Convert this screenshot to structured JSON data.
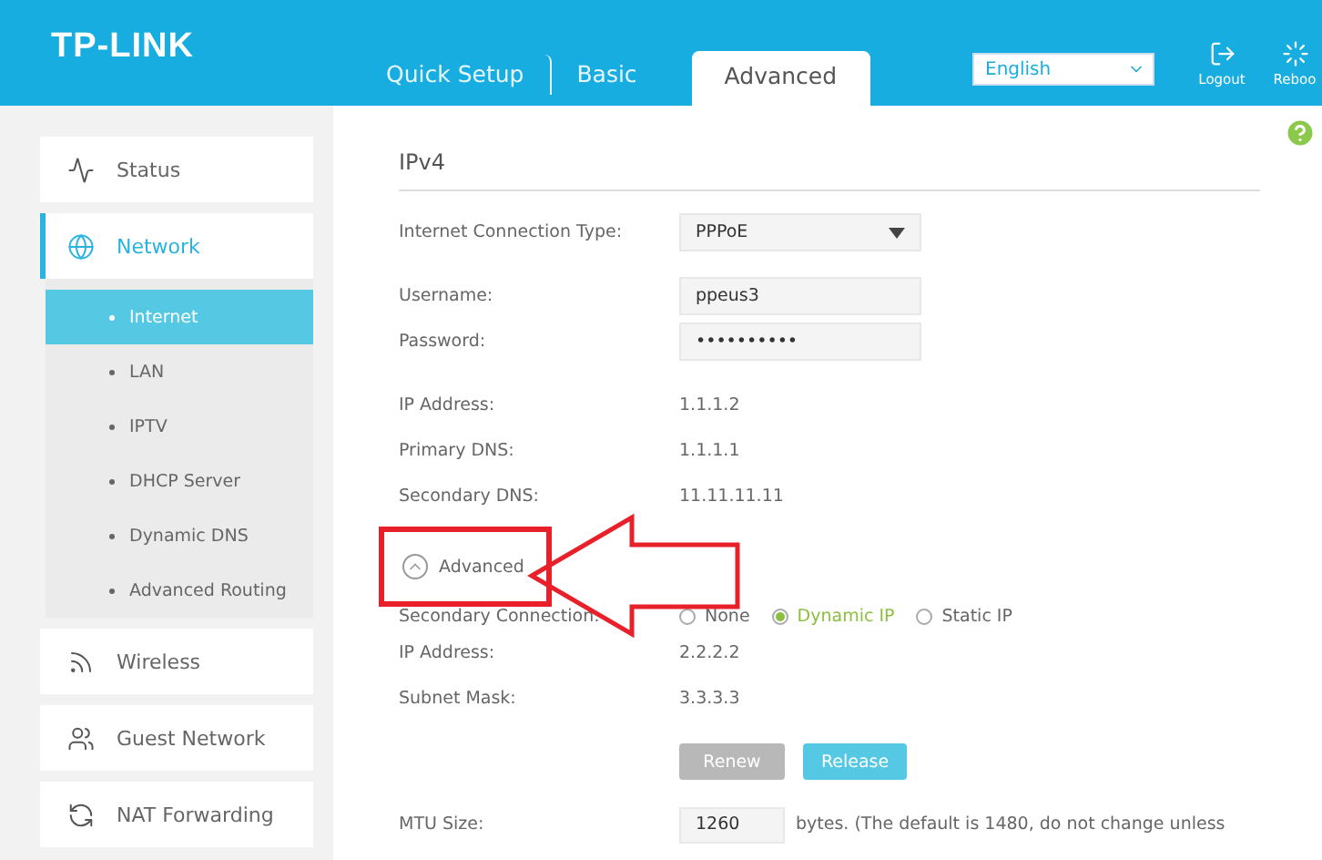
{
  "header": {
    "logo": "TP-LINK",
    "tabs": [
      {
        "label": "Quick Setup",
        "selected": false
      },
      {
        "label": "Basic",
        "selected": false
      },
      {
        "label": "Advanced",
        "selected": true
      }
    ],
    "language": "English",
    "actions": [
      {
        "kind": "logout",
        "label": "Logout"
      },
      {
        "kind": "reboot",
        "label": "Reboo"
      }
    ]
  },
  "sidebar": {
    "items": [
      {
        "label": "Status",
        "selected": false
      },
      {
        "label": "Network",
        "selected": true,
        "expanded": true,
        "children": [
          {
            "label": "Internet",
            "selected": true
          },
          {
            "label": "LAN",
            "selected": false
          },
          {
            "label": "IPTV",
            "selected": false
          },
          {
            "label": "DHCP Server",
            "selected": false
          },
          {
            "label": "Dynamic DNS",
            "selected": false
          },
          {
            "label": "Advanced Routing",
            "selected": false
          }
        ]
      },
      {
        "label": "Wireless",
        "selected": false
      },
      {
        "label": "Guest Network",
        "selected": false
      },
      {
        "label": "NAT Forwarding",
        "selected": false
      }
    ]
  },
  "main": {
    "section_title": "IPv4",
    "groups": [
      {
        "fields": [
          {
            "kind": "select",
            "label": "Internet Connection Type:",
            "value": "PPPoE"
          }
        ]
      },
      {
        "fields": [
          {
            "kind": "input",
            "label": "Username:",
            "value": "ppeus3"
          },
          {
            "kind": "input",
            "label": "Password:",
            "value": "••••••••••"
          }
        ]
      },
      {
        "fields": [
          {
            "kind": "text",
            "label": "IP Address:",
            "value": "1.1.1.2"
          },
          {
            "kind": "text",
            "label": "Primary DNS:",
            "value": "1.1.1.1"
          },
          {
            "kind": "text",
            "label": "Secondary DNS:",
            "value": "11.11.11.11"
          }
        ]
      }
    ],
    "advanced_toggle": {
      "label": "Advanced",
      "expanded": true
    },
    "secondary_connection": {
      "label": "Secondary Connection:",
      "options": [
        {
          "label": "None",
          "selected": false
        },
        {
          "label": "Dynamic IP",
          "selected": true
        },
        {
          "label": "Static IP",
          "selected": false
        }
      ]
    },
    "secondary_fields": [
      {
        "label": "IP Address:",
        "value": "2.2.2.2"
      },
      {
        "label": "Subnet Mask:",
        "value": "3.3.3.3"
      }
    ],
    "buttons": [
      {
        "label": "Renew",
        "disabled": true
      },
      {
        "label": "Release",
        "disabled": false
      }
    ],
    "mtu": {
      "label": "MTU Size:",
      "value": "1260",
      "note": "bytes. (The default is 1480, do not change unless"
    }
  }
}
